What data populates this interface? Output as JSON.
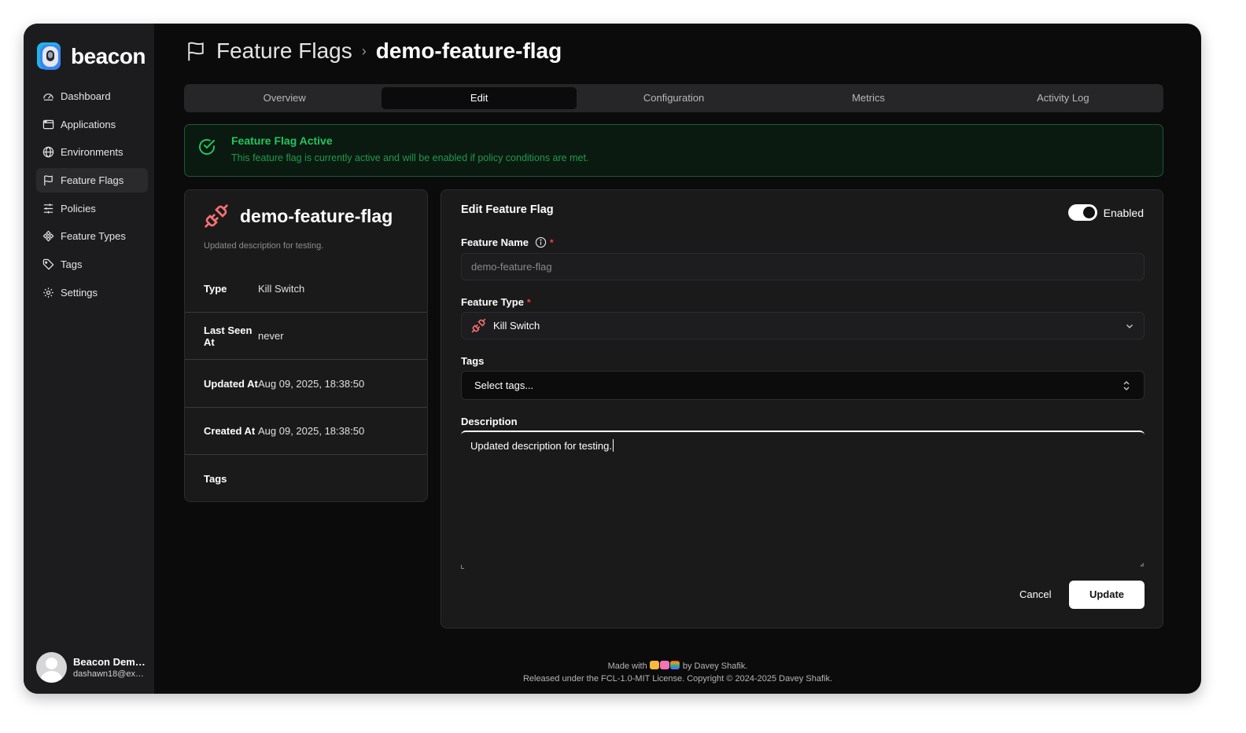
{
  "app": {
    "name": "beacon",
    "colors": {
      "accent": "#22c55e",
      "danger": "#ef4444",
      "logo": "#38bdf8",
      "brand_icon": "#f87171"
    }
  },
  "sidebar": {
    "items": [
      {
        "label": "Dashboard",
        "icon": "dashboard-icon"
      },
      {
        "label": "Applications",
        "icon": "window-icon"
      },
      {
        "label": "Environments",
        "icon": "globe-icon"
      },
      {
        "label": "Feature Flags",
        "icon": "flag-icon",
        "active": true
      },
      {
        "label": "Policies",
        "icon": "sliders-icon"
      },
      {
        "label": "Feature Types",
        "icon": "component-icon"
      },
      {
        "label": "Tags",
        "icon": "tag-icon"
      },
      {
        "label": "Settings",
        "icon": "gear-icon"
      }
    ],
    "user": {
      "name": "Beacon Demo…",
      "email": "dashawn18@ex…"
    }
  },
  "header": {
    "root": "Feature Flags",
    "separator": "›",
    "current": "demo-feature-flag"
  },
  "tabs": [
    "Overview",
    "Edit",
    "Configuration",
    "Metrics",
    "Activity Log"
  ],
  "active_tab": "Edit",
  "alert": {
    "title": "Feature Flag Active",
    "description": "This feature flag is currently active and will be enabled if policy conditions are met."
  },
  "info": {
    "title": "demo-feature-flag",
    "description": "Updated description for testing.",
    "rows": [
      {
        "label": "Type",
        "value": "Kill Switch"
      },
      {
        "label": "Last Seen At",
        "value": "never"
      },
      {
        "label": "Updated At",
        "value": "Aug 09, 2025, 18:38:50"
      },
      {
        "label": "Created At",
        "value": "Aug 09, 2025, 18:38:50"
      },
      {
        "label": "Tags",
        "value": ""
      }
    ]
  },
  "edit": {
    "title": "Edit Feature Flag",
    "toggle_label": "Enabled",
    "enabled": true,
    "feature_name_label": "Feature Name",
    "feature_name_value": "demo-feature-flag",
    "feature_type_label": "Feature Type",
    "feature_type_value": "Kill Switch",
    "tags_label": "Tags",
    "tags_placeholder": "Select tags...",
    "description_label": "Description",
    "description_value": "Updated description for testing.",
    "required_mark": "*",
    "cancel": "Cancel",
    "update": "Update"
  },
  "footer": {
    "made_prefix": "Made with",
    "made_suffix": "by Davey Shafik.",
    "license": "Released under the FCL-1.0-MIT License. Copyright © 2024-2025 Davey Shafik."
  }
}
